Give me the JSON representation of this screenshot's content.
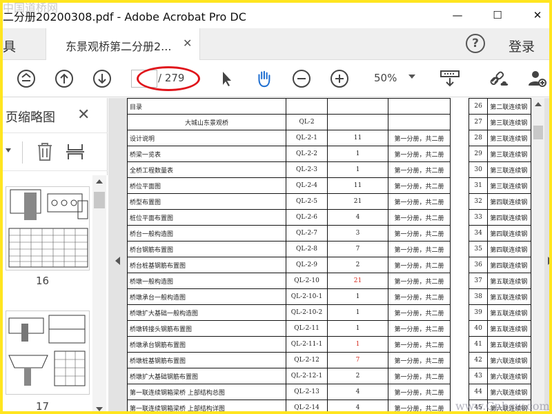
{
  "window": {
    "title": "二分册20200308.pdf - Adobe Acrobat Pro DC",
    "minimize": "—",
    "maximize": "☐",
    "close": "✕"
  },
  "tabs": {
    "tools": "具",
    "document": "东景观桥第二分册2...",
    "document_close": "✕",
    "help": "?",
    "login": "登录"
  },
  "toolbar": {
    "page_current": "",
    "page_total": "/ 279",
    "zoom": "50%",
    "highlight_color": "#e0141b"
  },
  "left_panel": {
    "title": "页缩略图",
    "close": "✕",
    "thumbnails": [
      {
        "page": "16"
      },
      {
        "page": "17"
      }
    ]
  },
  "table_main": [
    {
      "title": "目录",
      "code": "",
      "count": "",
      "note": "",
      "count_red": false,
      "title_center": false
    },
    {
      "title": "大城山东景观桥",
      "code": "QL-2",
      "count": "",
      "note": "",
      "count_red": false,
      "title_center": true
    },
    {
      "title": "设计说明",
      "code": "QL-2-1",
      "count": "11",
      "note": "第一分册，共二册",
      "count_red": false,
      "title_center": false
    },
    {
      "title": "桥梁一览表",
      "code": "QL-2-2",
      "count": "1",
      "note": "第一分册，共二册",
      "count_red": false,
      "title_center": false
    },
    {
      "title": "全桥工程数量表",
      "code": "QL-2-3",
      "count": "1",
      "note": "第一分册，共二册",
      "count_red": false,
      "title_center": false
    },
    {
      "title": "桥位平面图",
      "code": "QL-2-4",
      "count": "11",
      "note": "第一分册，共二册",
      "count_red": false,
      "title_center": false
    },
    {
      "title": "桥型布置图",
      "code": "QL-2-5",
      "count": "21",
      "note": "第一分册，共二册",
      "count_red": false,
      "title_center": false
    },
    {
      "title": "桩位平面布置图",
      "code": "QL-2-6",
      "count": "4",
      "note": "第一分册，共二册",
      "count_red": false,
      "title_center": false
    },
    {
      "title": "桥台一般构造图",
      "code": "QL-2-7",
      "count": "3",
      "note": "第一分册，共二册",
      "count_red": false,
      "title_center": false
    },
    {
      "title": "桥台钢筋布置图",
      "code": "QL-2-8",
      "count": "7",
      "note": "第一分册，共二册",
      "count_red": false,
      "title_center": false
    },
    {
      "title": "桥台桩基钢筋布置图",
      "code": "QL-2-9",
      "count": "2",
      "note": "第一分册，共二册",
      "count_red": false,
      "title_center": false
    },
    {
      "title": "桥墩一般构造图",
      "code": "QL-2-10",
      "count": "21",
      "note": "第一分册，共二册",
      "count_red": true,
      "title_center": false
    },
    {
      "title": "桥墩承台一般构造图",
      "code": "QL-2-10-1",
      "count": "1",
      "note": "第一分册，共二册",
      "count_red": false,
      "title_center": false
    },
    {
      "title": "桥墩扩大基础一般构造图",
      "code": "QL-2-10-2",
      "count": "1",
      "note": "第一分册，共二册",
      "count_red": false,
      "title_center": false
    },
    {
      "title": "桥墩转接头钢筋布置图",
      "code": "QL-2-11",
      "count": "1",
      "note": "第一分册，共二册",
      "count_red": false,
      "title_center": false
    },
    {
      "title": "桥墩承台钢筋布置图",
      "code": "QL-2-11-1",
      "count": "1",
      "note": "第一分册，共二册",
      "count_red": true,
      "title_center": false
    },
    {
      "title": "桥墩桩基钢筋布置图",
      "code": "QL-2-12",
      "count": "7",
      "note": "第一分册，共二册",
      "count_red": true,
      "title_center": false
    },
    {
      "title": "桥墩扩大基础钢筋布置图",
      "code": "QL-2-12-1",
      "count": "2",
      "note": "第一分册，共二册",
      "count_red": false,
      "title_center": false
    },
    {
      "title": "第一联连续钢箱梁桥 上部结构总图",
      "code": "QL-2-13",
      "count": "4",
      "note": "第一分册，共二册",
      "count_red": false,
      "title_center": false
    },
    {
      "title": "第一联连续钢箱梁桥 上部结构详图",
      "code": "QL-2-14",
      "count": "4",
      "note": "第一分册，共二册",
      "count_red": false,
      "title_center": false
    }
  ],
  "table_right": [
    {
      "n": "26",
      "t": "第二联连续钢"
    },
    {
      "n": "27",
      "t": "第三联连续钢"
    },
    {
      "n": "28",
      "t": "第三联连续钢"
    },
    {
      "n": "29",
      "t": "第三联连续钢"
    },
    {
      "n": "30",
      "t": "第三联连续钢"
    },
    {
      "n": "31",
      "t": "第三联连续钢"
    },
    {
      "n": "32",
      "t": "第四联连续钢"
    },
    {
      "n": "33",
      "t": "第四联连续钢"
    },
    {
      "n": "34",
      "t": "第四联连续钢"
    },
    {
      "n": "35",
      "t": "第四联连续钢"
    },
    {
      "n": "36",
      "t": "第四联连续钢"
    },
    {
      "n": "37",
      "t": "第五联连续钢"
    },
    {
      "n": "38",
      "t": "第五联连续钢"
    },
    {
      "n": "39",
      "t": "第五联连续钢"
    },
    {
      "n": "40",
      "t": "第五联连续钢"
    },
    {
      "n": "41",
      "t": "第五联连续钢"
    },
    {
      "n": "42",
      "t": "第六联连续钢"
    },
    {
      "n": "43",
      "t": "第六联连续钢"
    },
    {
      "n": "44",
      "t": "第六联连续钢"
    },
    {
      "n": "45",
      "t": "第六联连续钢"
    }
  ],
  "watermark": {
    "top": "中国道桥网",
    "bottom": "www.Cnbcw.com"
  }
}
